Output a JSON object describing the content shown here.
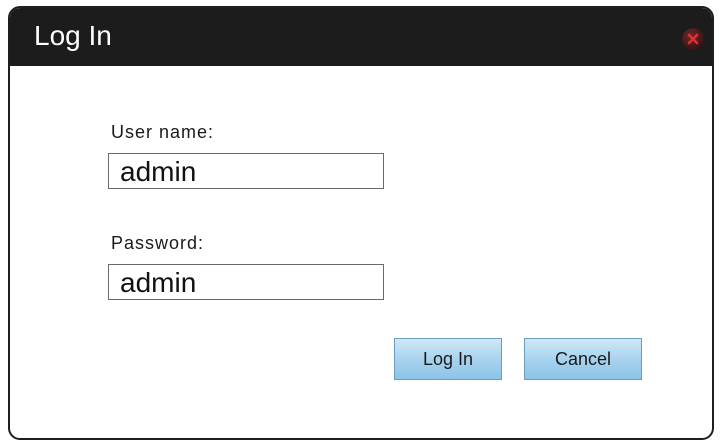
{
  "dialog": {
    "title": "Log In",
    "close_icon": "close-icon"
  },
  "form": {
    "username_label": "User name:",
    "username_value": "admin",
    "password_label": "Password:",
    "password_value": "admin"
  },
  "buttons": {
    "login_label": "Log In",
    "cancel_label": "Cancel"
  },
  "colors": {
    "titlebar": "#1c1c1c",
    "button_fill": "#a9d3ee",
    "close_x": "#e03030"
  }
}
